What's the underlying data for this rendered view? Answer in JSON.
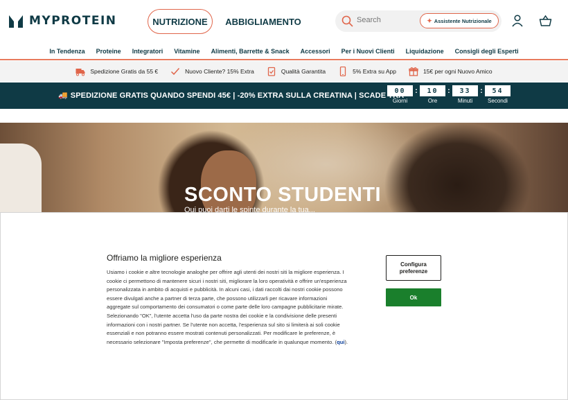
{
  "header": {
    "brand": "MYPROTEIN",
    "nav_primary": [
      "NUTRIZIONE",
      "ABBIGLIAMENTO"
    ],
    "search_placeholder": "Search",
    "assistant_label": "Assistente Nutrizionale",
    "icons": [
      "search-icon",
      "sparkle-icon",
      "user-icon",
      "basket-icon"
    ]
  },
  "category_nav": [
    "In Tendenza",
    "Proteine",
    "Integratori",
    "Vitamine",
    "Alimenti, Barrette & Snack",
    "Accessori",
    "Per i Nuovi Clienti",
    "Liquidazione",
    "Consigli degli Esperti"
  ],
  "usp_bar": [
    {
      "icon": "truck-icon",
      "text": "Spedizione Gratis da 55 €"
    },
    {
      "icon": "check-icon",
      "text": "Nuovo Cliente? 15% Extra"
    },
    {
      "icon": "clipboard-check-icon",
      "text": "Qualità Garantita"
    },
    {
      "icon": "phone-icon",
      "text": "5% Extra su App"
    },
    {
      "icon": "gift-icon",
      "text": "15€ per ogni Nuovo Amico"
    }
  ],
  "promo": {
    "text": "SPEDIZIONE GRATIS QUANDO SPENDI 45€ | -20% EXTRA SULLA CREATINA | SCADE TRA",
    "countdown": [
      {
        "value": "00",
        "label": "Giorni"
      },
      {
        "value": "10",
        "label": "Ore"
      },
      {
        "value": "33",
        "label": "Minuti"
      },
      {
        "value": "54",
        "label": "Secondi"
      }
    ]
  },
  "hero": {
    "title": "SCONTO STUDENTI",
    "subtitle": "Qui puoi darti le spinte durante la tua..."
  },
  "cookie": {
    "title": "Offriamo la migliore esperienza",
    "body": "Usiamo i cookie e altre tecnologie analoghe per offrire agli utenti dei nostri siti la migliore esperienza. I cookie ci permettono di mantenere sicuri i nostri siti, migliorare la loro operatività e offrire un'esperienza personalizzata in ambito di acquisti e pubblicità. In alcuni casi, i dati raccolti dai nostri cookie possono essere divulgati anche a partner di terza parte, che possono utilizzarli per ricavare informazioni aggregate sul comportamento dei consumatori o come parte delle loro campagne pubblicitarie mirate. Selezionando \"OK\", l'utente accetta l'uso da parte nostra dei cookie e la condivisione delle presenti informazioni con i nostri partner. Se l'utente non accetta, l'esperienza sul sito si limiterà ai soli cookie essenziali e non potranno essere mostrati contenuti personalizzati. Per modificare le preferenze, è necessario selezionare \"Imposta preferenze\", che permette di modificarle in qualunque momento.",
    "link_text": "qui",
    "body_end": ").",
    "body_link_prefix": " (",
    "configure_label": "Configura preferenze",
    "ok_label": "Ok",
    "link_color": "#0a3e99",
    "ok_color": "#1a7f2c"
  }
}
